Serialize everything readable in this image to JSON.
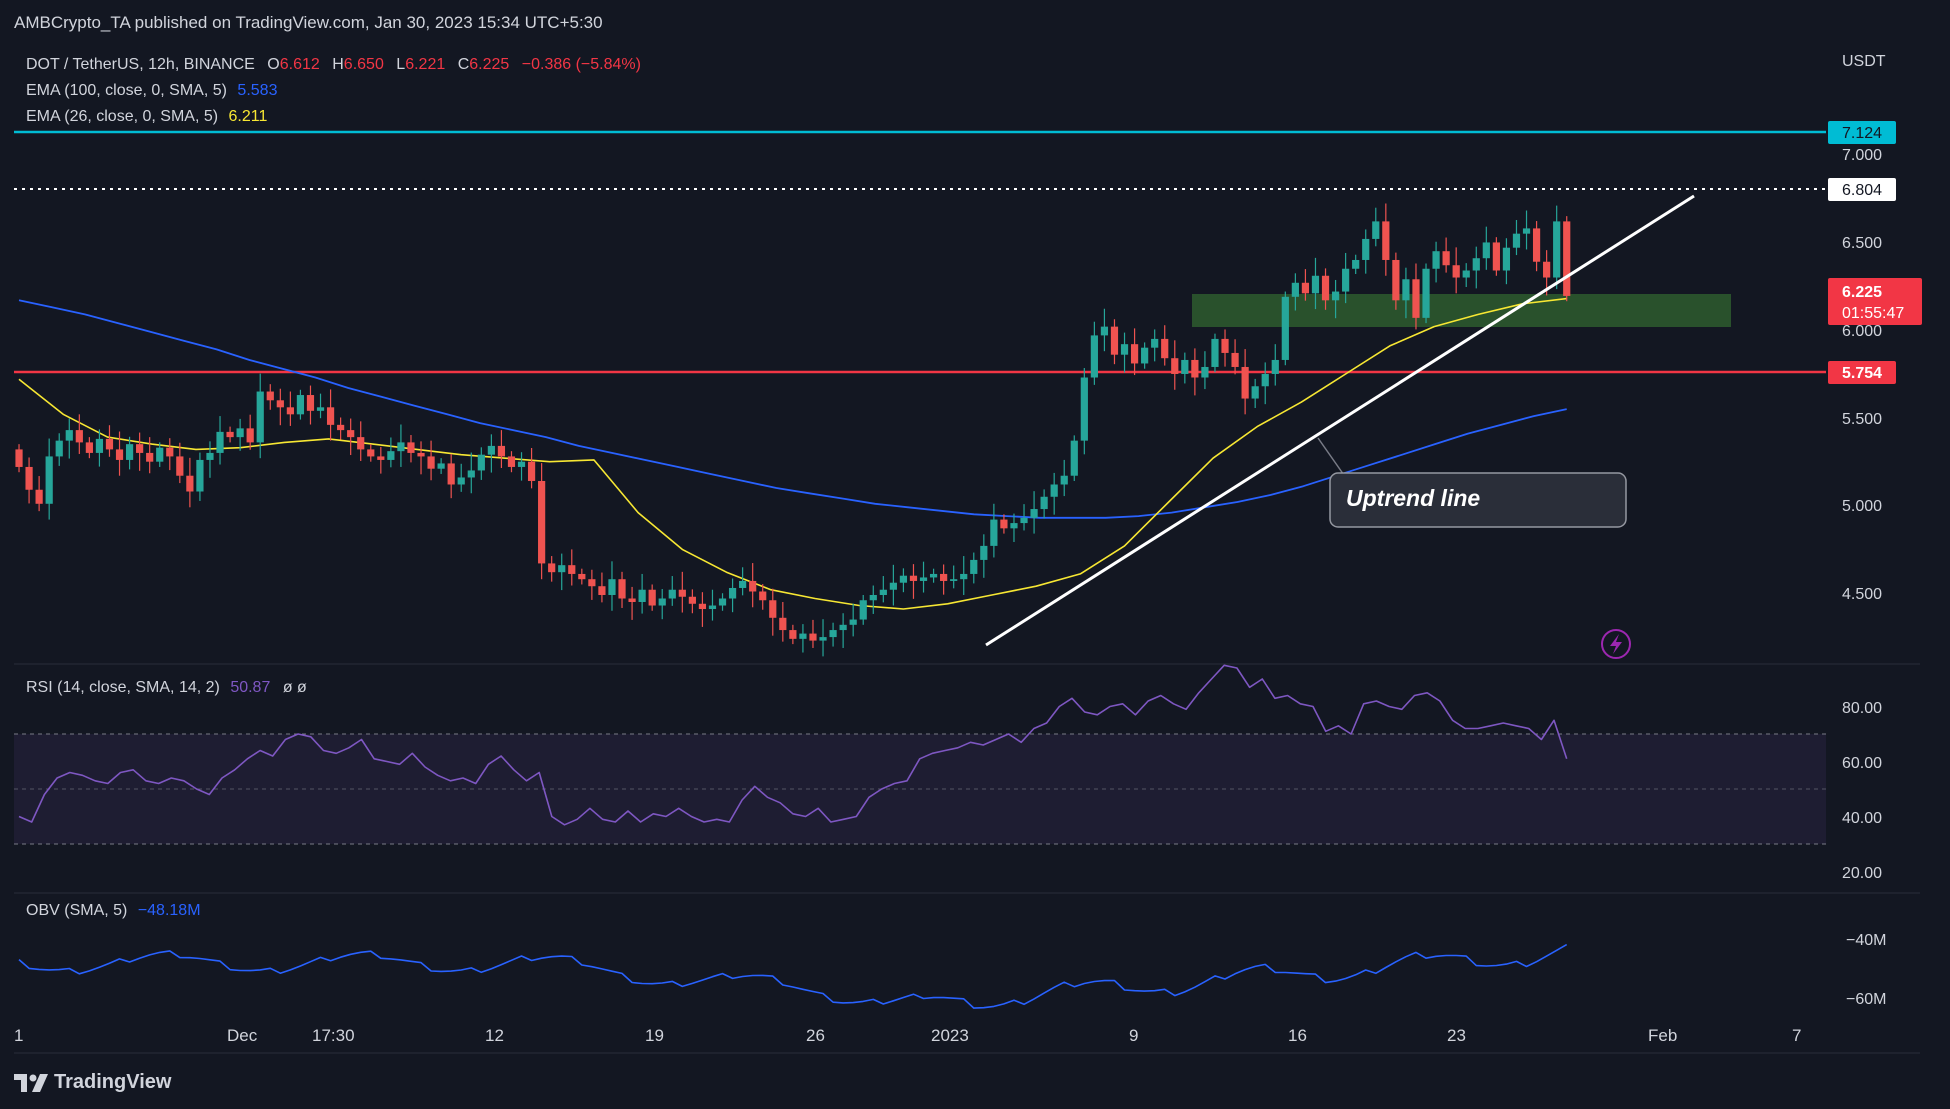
{
  "publisher": "AMBCrypto_TA published on TradingView.com, Jan 30, 2023 15:34 UTC+5:30",
  "brand": "TradingView",
  "colors": {
    "bg": "#131722",
    "up": "#26a69a",
    "down": "#ef5350",
    "ema100": "#2962ff",
    "ema26": "#f7e733",
    "rsi": "#7e57c2",
    "obv": "#2962ff",
    "resistance": "#00bcd4",
    "support": "#f23645",
    "zone": "#2e5c2e",
    "text": "#d1d4dc"
  },
  "legend": {
    "symbol": "DOT / TetherUS, 12h, BINANCE",
    "o_label": "O",
    "o": "6.612",
    "h_label": "H",
    "h": "6.650",
    "l_label": "L",
    "l": "6.221",
    "c_label": "C",
    "c": "6.225",
    "change": "−0.386 (−5.84%)",
    "ema100_label": "EMA (100, close, 0, SMA, 5)",
    "ema100_value": "5.583",
    "ema26_label": "EMA (26, close, 0, SMA, 5)",
    "ema26_value": "6.211",
    "rsi_label": "RSI (14, close, SMA, 14, 2)",
    "rsi_value": "50.87",
    "rsi_extra": "ø  ø",
    "obv_label": "OBV (SMA, 5)",
    "obv_value": "−48.18M"
  },
  "price_axis": {
    "currency": "USDT",
    "ticks": [
      "7.000",
      "6.500",
      "6.000",
      "5.500",
      "5.000",
      "4.500"
    ],
    "tags": {
      "resistance": "7.124",
      "high": "6.804",
      "last_price": "6.225",
      "countdown": "01:55:47",
      "support": "5.754"
    }
  },
  "rsi_axis": {
    "ticks": [
      "80.00",
      "60.00",
      "40.00",
      "20.00"
    ]
  },
  "obv_axis": {
    "ticks": [
      "−40M",
      "−60M"
    ]
  },
  "time_axis": {
    "labels": [
      "1",
      "Dec",
      "17:30",
      "12",
      "19",
      "26",
      "2023",
      "9",
      "16",
      "23",
      "Feb",
      "7"
    ]
  },
  "annotation": {
    "label": "Uptrend line"
  },
  "chart_data": {
    "type": "candlestick",
    "title": "DOT / TetherUS, 12h, BINANCE",
    "x_range_bars": [
      0,
      160
    ],
    "ylim": [
      4.1,
      7.35
    ],
    "closes": [
      5.25,
      5.12,
      5.04,
      5.31,
      5.4,
      5.46,
      5.39,
      5.33,
      5.41,
      5.35,
      5.29,
      5.38,
      5.33,
      5.28,
      5.36,
      5.31,
      5.2,
      5.11,
      5.29,
      5.33,
      5.45,
      5.42,
      5.47,
      5.39,
      5.68,
      5.63,
      5.59,
      5.55,
      5.66,
      5.57,
      5.59,
      5.49,
      5.46,
      5.42,
      5.35,
      5.31,
      5.29,
      5.34,
      5.39,
      5.33,
      5.31,
      5.24,
      5.27,
      5.15,
      5.19,
      5.23,
      5.32,
      5.37,
      5.31,
      5.25,
      5.28,
      5.17,
      4.7,
      4.65,
      4.69,
      4.64,
      4.61,
      4.57,
      4.52,
      4.61,
      4.5,
      4.48,
      4.55,
      4.46,
      4.5,
      4.55,
      4.51,
      4.47,
      4.44,
      4.46,
      4.5,
      4.56,
      4.6,
      4.54,
      4.49,
      4.39,
      4.32,
      4.27,
      4.3,
      4.26,
      4.28,
      4.32,
      4.35,
      4.38,
      4.49,
      4.52,
      4.55,
      4.59,
      4.63,
      4.6,
      4.62,
      4.64,
      4.6,
      4.61,
      4.64,
      4.72,
      4.8,
      4.95,
      4.9,
      4.93,
      4.96,
      5.01,
      5.08,
      5.15,
      5.2,
      5.4,
      5.76,
      6.0,
      6.05,
      5.89,
      5.95,
      5.84,
      5.93,
      5.98,
      5.87,
      5.78,
      5.86,
      5.76,
      5.82,
      5.98,
      5.9,
      5.82,
      5.64,
      5.71,
      5.78,
      5.86,
      6.22,
      6.3,
      6.24,
      6.34,
      6.2,
      6.25,
      6.38,
      6.43,
      6.55,
      6.65,
      6.43,
      6.2,
      6.32,
      6.1,
      6.38,
      6.48,
      6.4,
      6.33,
      6.37,
      6.44,
      6.53,
      6.37,
      6.5,
      6.58,
      6.61,
      6.42,
      6.33,
      6.65,
      6.225
    ],
    "ema100": [
      6.2,
      6.16,
      6.12,
      6.07,
      6.02,
      5.97,
      5.92,
      5.86,
      5.81,
      5.76,
      5.7,
      5.65,
      5.6,
      5.55,
      5.5,
      5.46,
      5.42,
      5.37,
      5.33,
      5.29,
      5.25,
      5.21,
      5.17,
      5.13,
      5.1,
      5.07,
      5.04,
      5.02,
      5.0,
      4.98,
      4.97,
      4.96,
      4.96,
      4.96,
      4.97,
      4.99,
      5.02,
      5.05,
      5.09,
      5.14,
      5.2,
      5.26,
      5.32,
      5.38,
      5.44,
      5.49,
      5.54,
      5.58
    ],
    "ema26": [
      5.75,
      5.55,
      5.42,
      5.38,
      5.35,
      5.36,
      5.39,
      5.41,
      5.38,
      5.35,
      5.32,
      5.3,
      5.28,
      5.29,
      4.99,
      4.78,
      4.65,
      4.55,
      4.5,
      4.46,
      4.44,
      4.47,
      4.52,
      4.57,
      4.64,
      4.8,
      5.05,
      5.3,
      5.48,
      5.62,
      5.78,
      5.94,
      6.05,
      6.12,
      6.18,
      6.21
    ],
    "rsi_values": [
      30,
      28,
      38,
      44,
      46,
      45,
      43,
      42,
      46,
      47,
      43,
      42,
      44,
      43,
      40,
      38,
      44,
      47,
      51,
      54,
      52,
      58,
      60,
      59,
      54,
      53,
      55,
      58,
      51,
      50,
      49,
      53,
      48,
      45,
      43,
      44,
      42,
      49,
      52,
      47,
      43,
      46,
      30,
      27,
      29,
      33,
      29,
      28,
      32,
      28,
      31,
      30,
      33,
      30,
      28,
      29,
      28,
      36,
      41,
      37,
      35,
      31,
      30,
      33,
      28,
      29,
      30,
      37,
      40,
      42,
      43,
      51,
      53,
      54,
      55,
      57,
      56,
      58,
      60,
      57,
      62,
      64,
      70,
      73,
      68,
      67,
      70,
      71,
      67,
      72,
      74,
      71,
      69,
      75,
      80,
      85,
      84,
      77,
      80,
      73,
      74,
      71,
      70,
      61,
      63,
      60,
      71,
      72,
      70,
      69,
      74,
      75,
      72,
      65,
      62,
      62,
      63,
      64,
      63,
      62,
      58,
      65,
      51
    ]
  }
}
